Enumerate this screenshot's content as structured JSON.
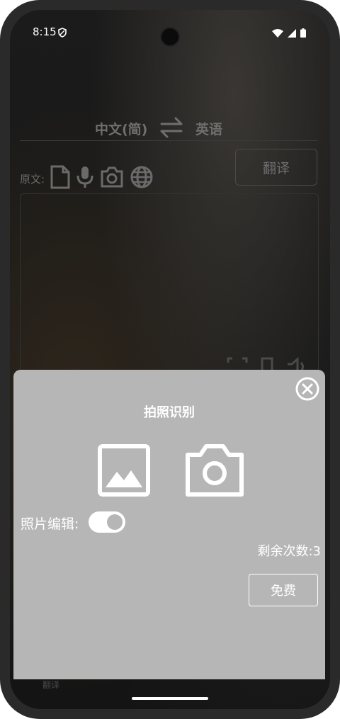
{
  "status_bar": {
    "time": "8:15"
  },
  "translator": {
    "source_language": "中文(简)",
    "target_language": "英语",
    "source_label": "原文:",
    "translate_button": "翻译"
  },
  "bottom_nav": {
    "items": [
      "翻译",
      "",
      "",
      ""
    ]
  },
  "photo_sheet": {
    "title": "拍照识别",
    "photo_edit_label": "照片编辑:",
    "photo_edit_enabled": true,
    "remaining_label": "剩余次数:3",
    "free_button": "免费"
  },
  "colors": {
    "sheet_bg": "#b6b6b6",
    "sheet_text": "#ffffff",
    "background": "#161616"
  }
}
